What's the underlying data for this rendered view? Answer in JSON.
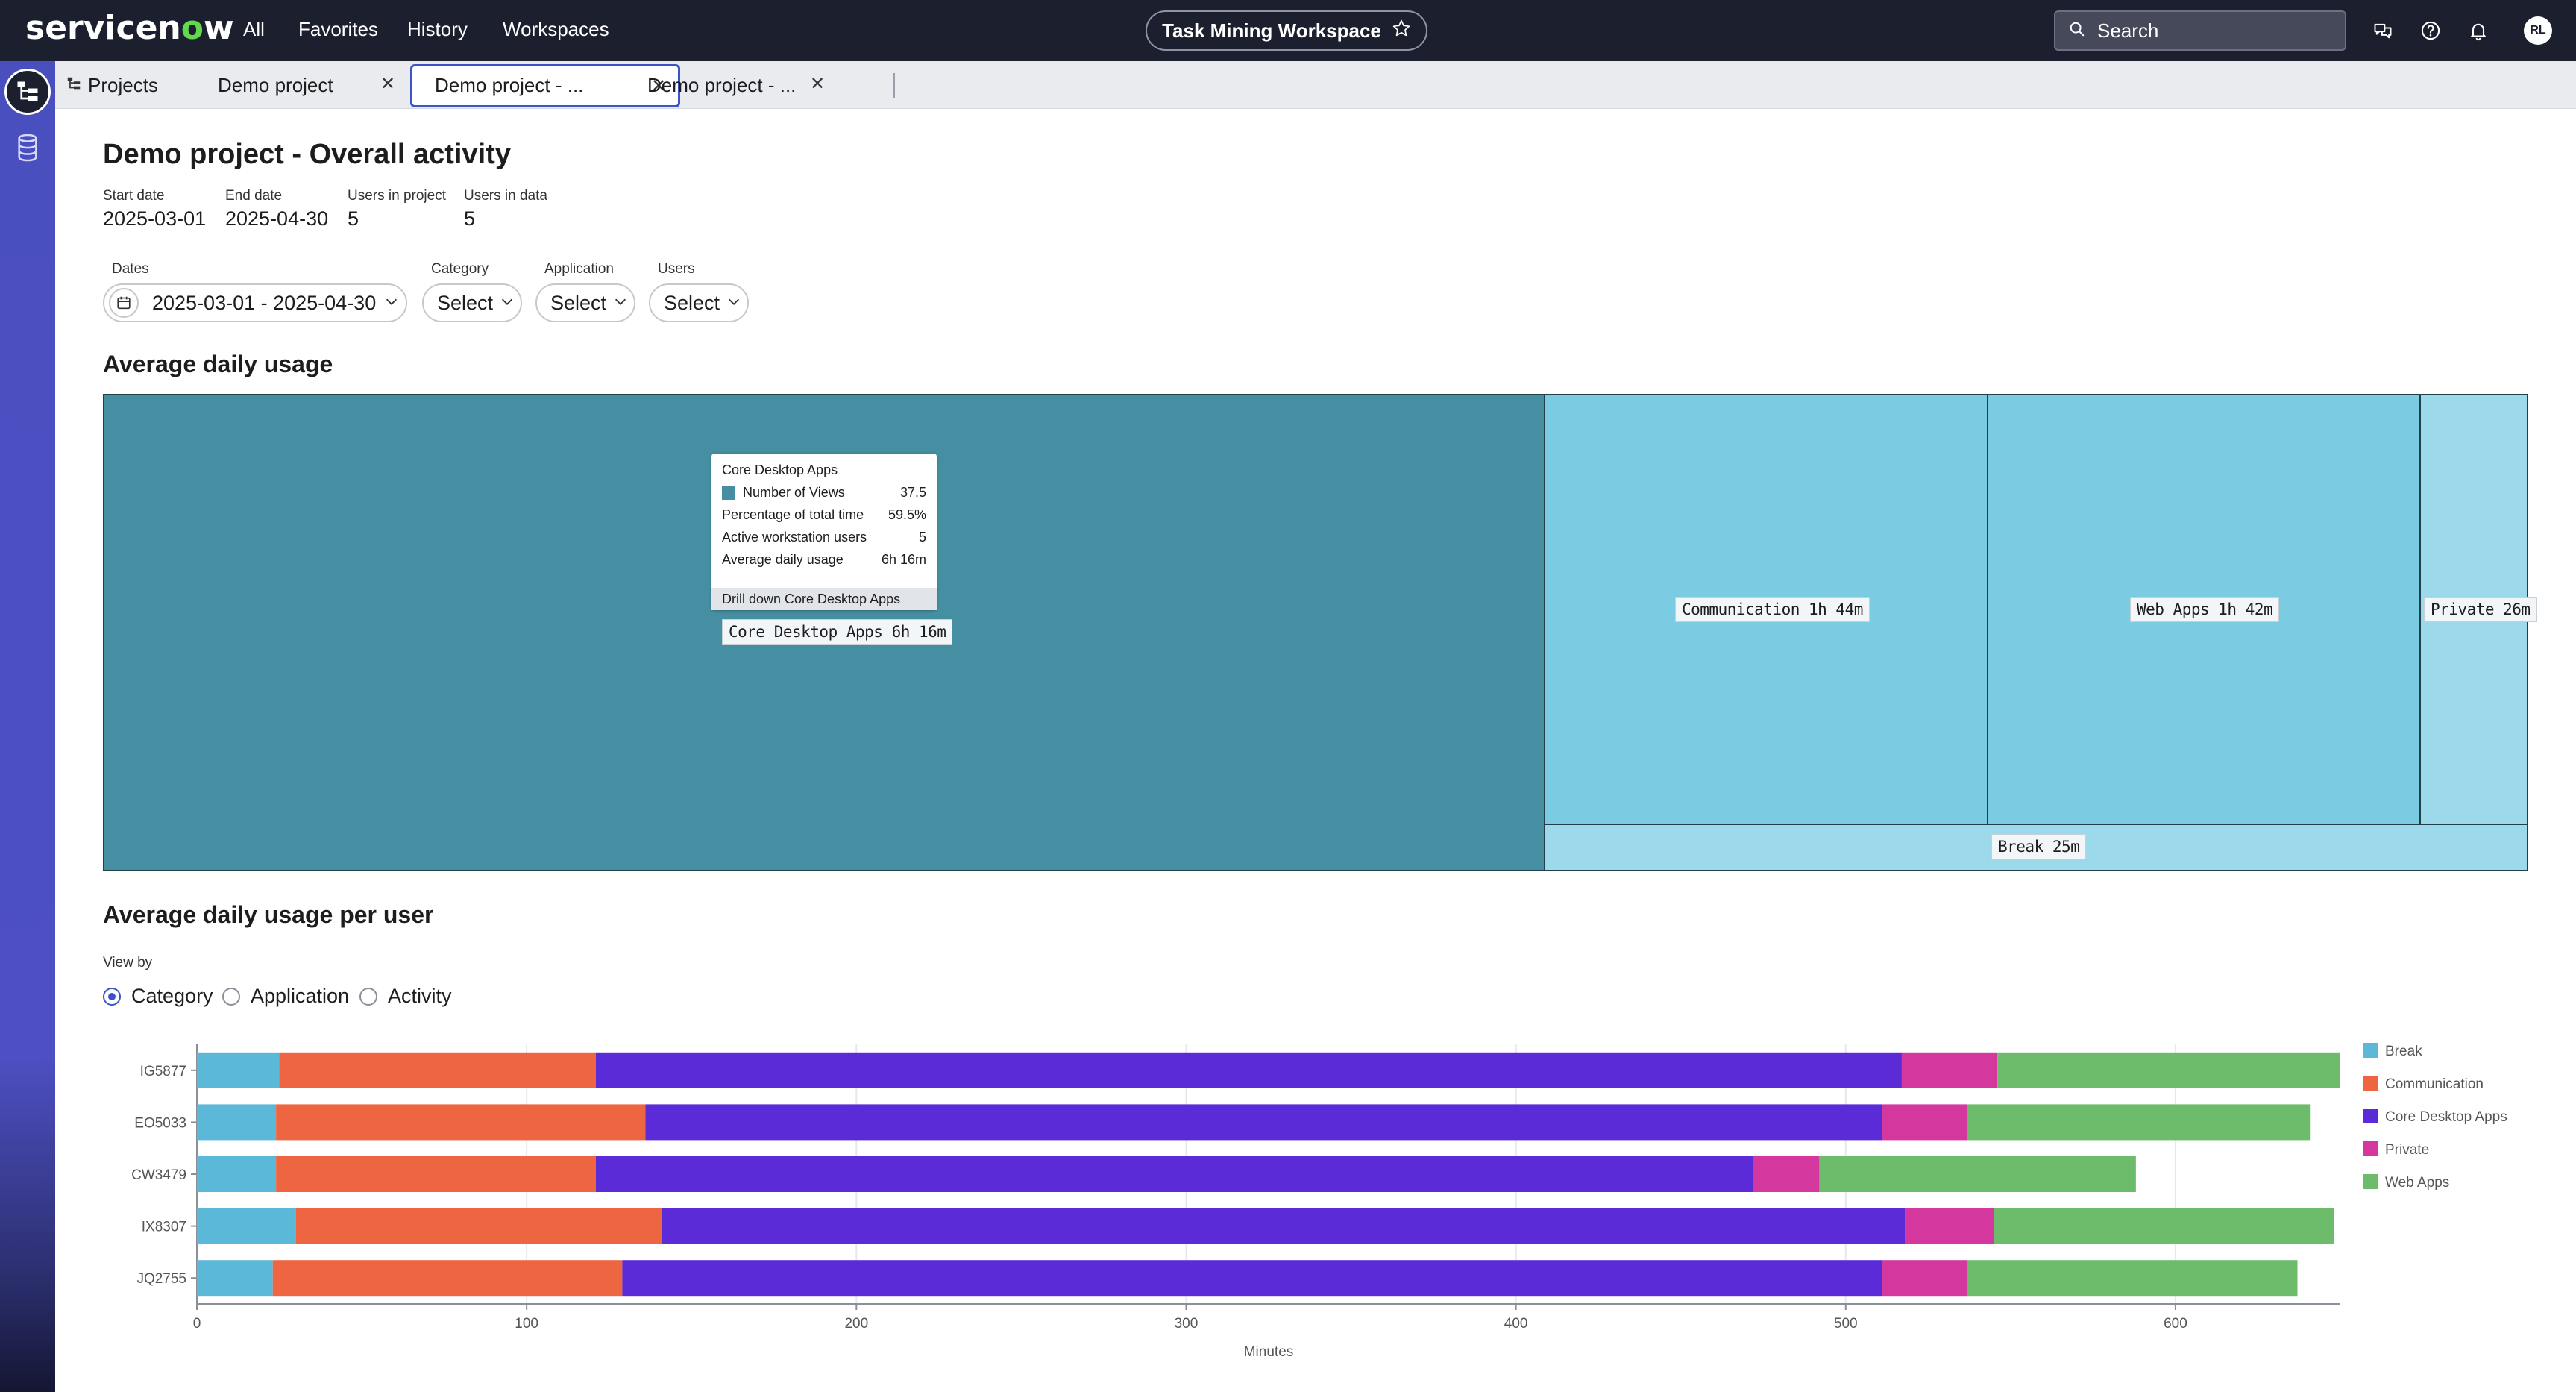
{
  "header": {
    "logo_pre": "servicen",
    "logo_o": "o",
    "logo_post": "w",
    "nav": [
      "All",
      "Favorites",
      "History",
      "Workspaces"
    ],
    "workspace_title": "Task Mining Workspace",
    "search_placeholder": "Search",
    "avatar_initials": "RL"
  },
  "tabs": {
    "projects": "Projects",
    "tab1": "Demo project",
    "tab2": "Demo project - ...",
    "tab3": "Demo project - ..."
  },
  "page": {
    "title": "Demo project - Overall activity",
    "meta": [
      {
        "label": "Start date",
        "value": "2025-03-01"
      },
      {
        "label": "End date",
        "value": "2025-04-30"
      },
      {
        "label": "Users in project",
        "value": "5"
      },
      {
        "label": "Users in data",
        "value": "5"
      }
    ],
    "filters": {
      "dates_label": "Dates",
      "dates_value": "2025-03-01 - 2025-04-30",
      "category_label": "Category",
      "category_value": "Select",
      "application_label": "Application",
      "application_value": "Select",
      "users_label": "Users",
      "users_value": "Select"
    }
  },
  "treemap": {
    "title": "Average daily usage",
    "cells": [
      {
        "label": "Core Desktop Apps 6h 16m",
        "color": "#468fa2"
      },
      {
        "label": "Communication 1h 44m",
        "color": "#7bcbe2"
      },
      {
        "label": "Web Apps 1h 42m",
        "color": "#7bcbe2"
      },
      {
        "label": "Private 26m",
        "color": "#9cd9ea"
      },
      {
        "label": "Break 25m",
        "color": "#9cd9ea"
      }
    ],
    "tooltip": {
      "title": "Core Desktop Apps",
      "rows": [
        {
          "label": "Number of Views",
          "value": "37.5"
        },
        {
          "label": "Percentage of total time",
          "value": "59.5%"
        },
        {
          "label": "Active workstation users",
          "value": "5"
        },
        {
          "label": "Average daily usage",
          "value": "6h 16m"
        }
      ],
      "drill": "Drill down Core Desktop Apps"
    }
  },
  "per_user": {
    "title": "Average daily usage per user",
    "view_by_label": "View by",
    "options": [
      "Category",
      "Application",
      "Activity"
    ],
    "selected": "Category"
  },
  "chart_data": {
    "type": "bar",
    "orientation": "horizontal",
    "stacked": true,
    "categories": [
      "IG5877",
      "EO5033",
      "CW3479",
      "IX8307",
      "JQ2755"
    ],
    "xlabel": "Minutes",
    "ylabel": "",
    "xlim": [
      0,
      650
    ],
    "xticks": [
      0,
      100,
      200,
      300,
      400,
      500,
      600
    ],
    "grid": true,
    "legend": "right",
    "series": [
      {
        "name": "Break",
        "color": "#5bb8d9",
        "values": [
          25,
          24,
          24,
          30,
          23
        ]
      },
      {
        "name": "Communication",
        "color": "#ee6541",
        "values": [
          96,
          112,
          97,
          111,
          106
        ]
      },
      {
        "name": "Core Desktop Apps",
        "color": "#5a2bd6",
        "values": [
          396,
          375,
          351,
          377,
          382
        ]
      },
      {
        "name": "Private",
        "color": "#d4389e",
        "values": [
          29,
          26,
          20,
          27,
          26
        ]
      },
      {
        "name": "Web Apps",
        "color": "#6dbc6b",
        "values": [
          104,
          104,
          96,
          103,
          100
        ]
      }
    ]
  }
}
